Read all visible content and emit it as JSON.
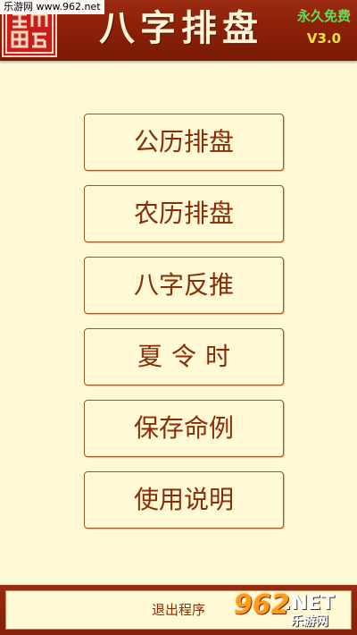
{
  "header": {
    "title": "八字排盘",
    "free_label": "永久免费",
    "version": "V3.0",
    "seal_icon": "red-seal-stamp",
    "background_color": "#8c2108"
  },
  "watermark": {
    "top_text": "乐游网 www.962.net",
    "logo_number": "962",
    "logo_net": ".NET",
    "logo_name": "乐游网"
  },
  "menu": {
    "items": [
      {
        "label": "公历排盘"
      },
      {
        "label": "农历排盘"
      },
      {
        "label": "八字反推"
      },
      {
        "label": "夏令时"
      },
      {
        "label": "保存命例"
      },
      {
        "label": "使用说明"
      }
    ],
    "text_color": "#8a2c08",
    "border_color": "#9a5a2a"
  },
  "footer": {
    "exit_label": "退出程序"
  },
  "page": {
    "background_color": "#fff9d6"
  }
}
